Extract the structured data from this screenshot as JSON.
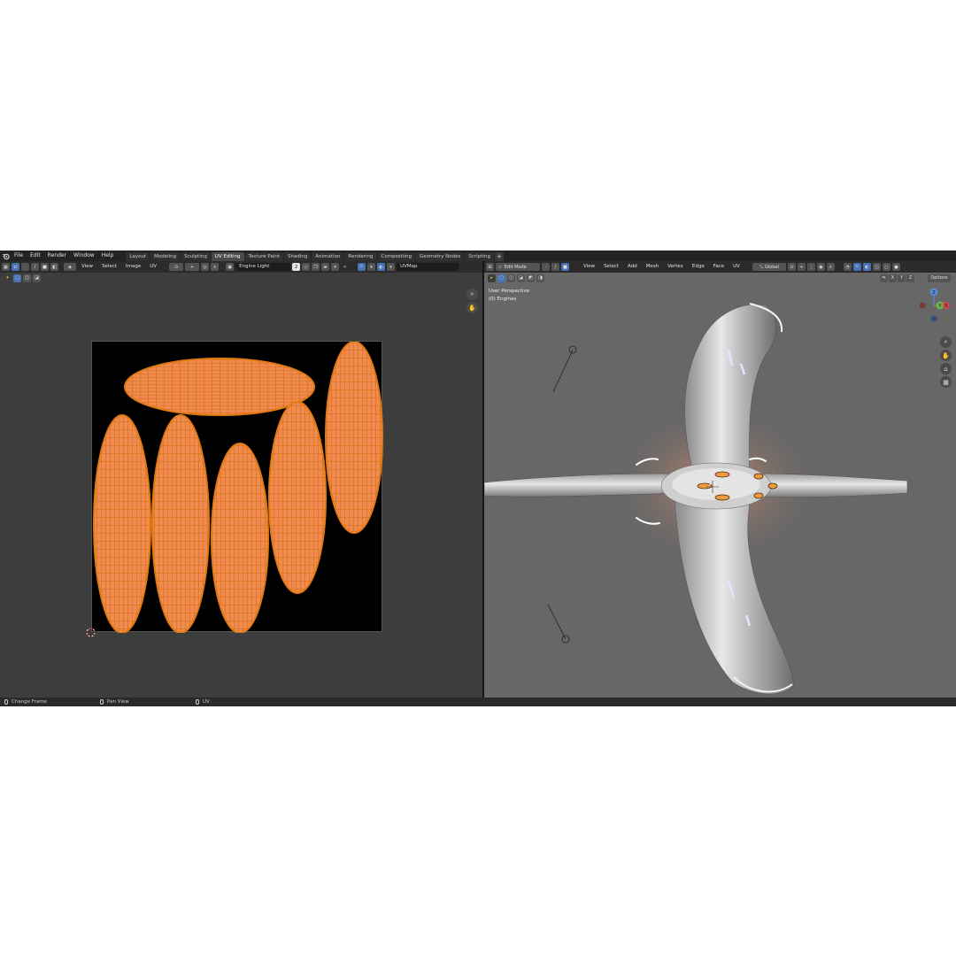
{
  "menu": {
    "items": [
      "File",
      "Edit",
      "Render",
      "Window",
      "Help"
    ]
  },
  "workspaces": {
    "tabs": [
      "Layout",
      "Modeling",
      "Sculpting",
      "UV Editing",
      "Texture Paint",
      "Shading",
      "Animation",
      "Rendering",
      "Compositing",
      "Geometry Nodes",
      "Scripting"
    ],
    "active": "UV Editing",
    "add": "+"
  },
  "uv_editor": {
    "menus": [
      "View",
      "Select",
      "Image",
      "UV"
    ],
    "image_name": "Engine Light",
    "image_users": "2",
    "uv_map": "UVMap"
  },
  "viewport": {
    "mode": "Edit Mode",
    "menus": [
      "View",
      "Select",
      "Add",
      "Mesh",
      "Vertex",
      "Edge",
      "Face",
      "UV"
    ],
    "transform_orientation": "Global",
    "mirror_axes": [
      "X",
      "Y",
      "Z"
    ],
    "options_label": "Options",
    "perspective_label": "User Perspective",
    "object_label": "(0) Engines",
    "gizmo_labels": {
      "z": "Z",
      "y": "Y",
      "x": "X"
    }
  },
  "statusbar": {
    "left": "Change Frame",
    "middle": "Pan View",
    "right": "UV"
  },
  "colors": {
    "uv_fill": "#f08a50",
    "uv_edge": "#e07a10",
    "accent": "#4772b3",
    "uv_background": "#000000"
  }
}
